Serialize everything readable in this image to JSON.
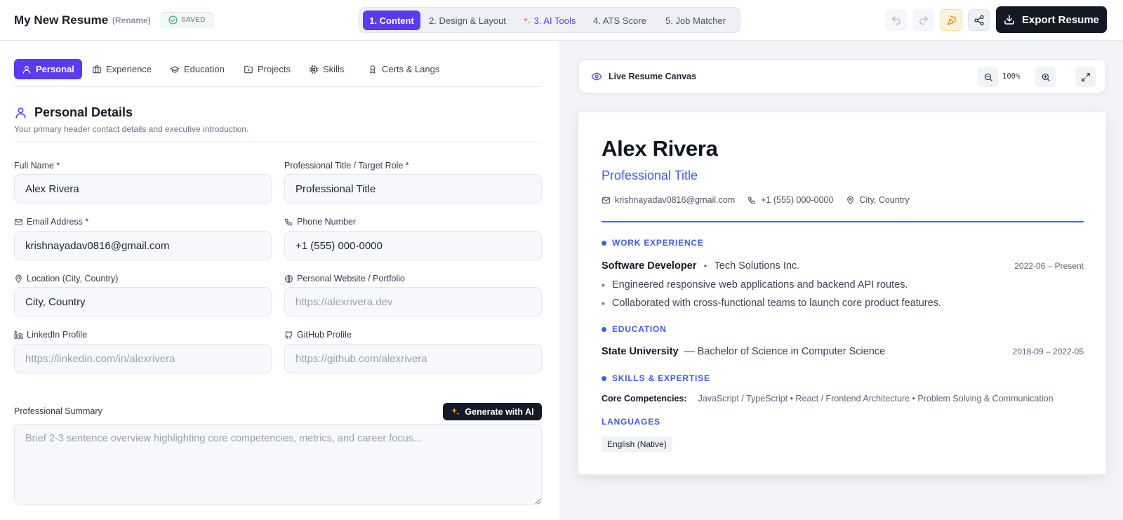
{
  "header": {
    "title": "My New Resume",
    "rename_label": "(Rename)",
    "saved_label": "SAVED",
    "steps": [
      {
        "label": "1. Content"
      },
      {
        "label": "2. Design & Layout"
      },
      {
        "label": "3. AI Tools"
      },
      {
        "label": "4. ATS Score"
      },
      {
        "label": "5. Job Matcher"
      }
    ],
    "export_label": "Export Resume",
    "colors": {
      "accent": "#5b3bf0",
      "dark": "#141925"
    }
  },
  "editor": {
    "tabs": [
      {
        "label": "Personal",
        "icon": "user-icon"
      },
      {
        "label": "Experience",
        "icon": "briefcase-icon"
      },
      {
        "label": "Education",
        "icon": "graduation-cap-icon"
      },
      {
        "label": "Projects",
        "icon": "folder-icon"
      },
      {
        "label": "Skills",
        "icon": "chip-icon"
      },
      {
        "label": "Certs & Langs",
        "icon": "award-icon"
      }
    ],
    "section_title": "Personal Details",
    "section_subtitle": "Your primary header contact details and executive introduction.",
    "fields": {
      "full_name": {
        "label": "Full Name *",
        "value": "Alex Rivera"
      },
      "professional_title": {
        "label": "Professional Title / Target Role *",
        "value": "Professional Title"
      },
      "email": {
        "label": "Email Address *",
        "value": "krishnayadav0816@gmail.com"
      },
      "phone": {
        "label": "Phone Number",
        "value": "+1 (555) 000-0000"
      },
      "location": {
        "label": "Location (City, Country)",
        "value": "City, Country"
      },
      "website": {
        "label": "Personal Website / Portfolio",
        "placeholder": "https://alexrivera.dev"
      },
      "linkedin": {
        "label": "LinkedIn Profile",
        "placeholder": "https://linkedin.com/in/alexrivera"
      },
      "github": {
        "label": "GitHub Profile",
        "placeholder": "https://github.com/alexrivera"
      },
      "summary": {
        "label": "Professional Summary",
        "placeholder": "Brief 2-3 sentence overview highlighting core competencies, metrics, and career focus..."
      }
    },
    "generate_label": "Generate with AI"
  },
  "preview": {
    "canvas_title": "Live Resume Canvas",
    "zoom": "100%",
    "resume": {
      "name": "Alex Rivera",
      "title": "Professional Title",
      "email": "krishnayadav0816@gmail.com",
      "phone": "+1 (555) 000-0000",
      "location": "City, Country",
      "experience_heading": "WORK EXPERIENCE",
      "job_role": "Software Developer",
      "job_sep": "•",
      "job_company": "Tech Solutions Inc.",
      "job_dates": "2022-06 – Present",
      "bullets": [
        "Engineered responsive web applications and backend API routes.",
        "Collaborated with cross-functional teams to launch core product features."
      ],
      "education_heading": "EDUCATION",
      "school": "State University",
      "degree": "— Bachelor of Science in Computer Science",
      "edu_dates": "2018-09 – 2022-05",
      "skills_heading": "SKILLS & EXPERTISE",
      "skills_key": "Core Competencies:",
      "skills_value": "JavaScript / TypeScript • React / Frontend Architecture • Problem Solving & Communication",
      "languages_heading": "LANGUAGES",
      "language": "English (Native)"
    }
  }
}
